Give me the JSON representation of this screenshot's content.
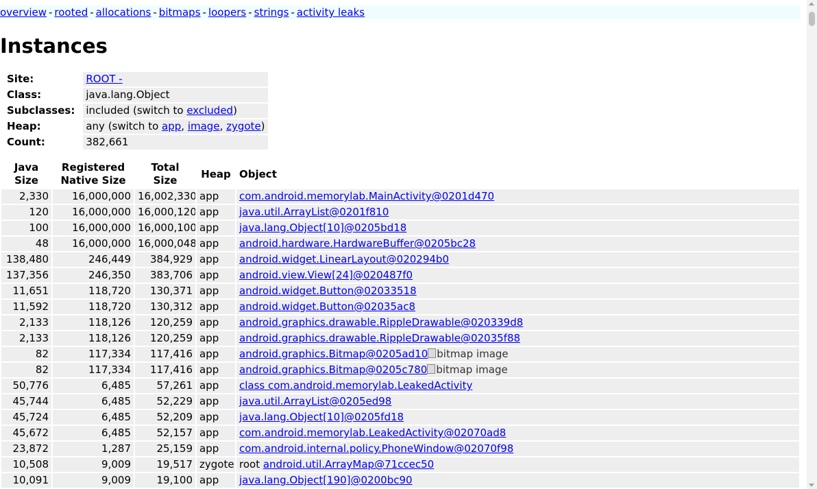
{
  "nav": {
    "links": [
      {
        "label": "overview",
        "id": "overview"
      },
      {
        "label": "rooted",
        "id": "rooted"
      },
      {
        "label": "allocations",
        "id": "allocations"
      },
      {
        "label": "bitmaps",
        "id": "bitmaps"
      },
      {
        "label": "loopers",
        "id": "loopers"
      },
      {
        "label": "strings",
        "id": "strings"
      },
      {
        "label": "activity leaks",
        "id": "activity-leaks"
      }
    ],
    "separator": "-"
  },
  "page_title": "Instances",
  "info": {
    "site": {
      "label": "Site:",
      "link": "ROOT -"
    },
    "class": {
      "label": "Class:",
      "value": "java.lang.Object"
    },
    "subclasses": {
      "label": "Subclasses:",
      "prefix": "included (switch to ",
      "link": "excluded",
      "suffix": ")"
    },
    "heap": {
      "label": "Heap:",
      "prefix": "any (switch to ",
      "links": [
        "app",
        "image",
        "zygote"
      ],
      "comma": ", ",
      "suffix": ")"
    },
    "count": {
      "label": "Count:",
      "value": "382,661"
    }
  },
  "table": {
    "headers": {
      "java_size": [
        "Java",
        "Size"
      ],
      "native_size": [
        "Registered",
        "Native Size"
      ],
      "total_size": [
        "Total",
        "Size"
      ],
      "heap": "Heap",
      "object": "Object"
    },
    "rows": [
      {
        "java": "2,330",
        "native": "16,000,000",
        "total": "16,002,330",
        "heap": "app",
        "prefix": "",
        "object": "com.android.memorylab.MainActivity@0201d470",
        "bitmap": ""
      },
      {
        "java": "120",
        "native": "16,000,000",
        "total": "16,000,120",
        "heap": "app",
        "prefix": "",
        "object": "java.util.ArrayList@0201f810",
        "bitmap": ""
      },
      {
        "java": "100",
        "native": "16,000,000",
        "total": "16,000,100",
        "heap": "app",
        "prefix": "",
        "object": "java.lang.Object[10]@0205bd18",
        "bitmap": ""
      },
      {
        "java": "48",
        "native": "16,000,000",
        "total": "16,000,048",
        "heap": "app",
        "prefix": "",
        "object": "android.hardware.HardwareBuffer@0205bc28",
        "bitmap": ""
      },
      {
        "java": "138,480",
        "native": "246,449",
        "total": "384,929",
        "heap": "app",
        "prefix": "",
        "object": "android.widget.LinearLayout@020294b0",
        "bitmap": ""
      },
      {
        "java": "137,356",
        "native": "246,350",
        "total": "383,706",
        "heap": "app",
        "prefix": "",
        "object": "android.view.View[24]@020487f0",
        "bitmap": ""
      },
      {
        "java": "11,651",
        "native": "118,720",
        "total": "130,371",
        "heap": "app",
        "prefix": "",
        "object": "android.widget.Button@02033518",
        "bitmap": ""
      },
      {
        "java": "11,592",
        "native": "118,720",
        "total": "130,312",
        "heap": "app",
        "prefix": "",
        "object": "android.widget.Button@02035ac8",
        "bitmap": ""
      },
      {
        "java": "2,133",
        "native": "118,126",
        "total": "120,259",
        "heap": "app",
        "prefix": "",
        "object": "android.graphics.drawable.RippleDrawable@020339d8",
        "bitmap": ""
      },
      {
        "java": "2,133",
        "native": "118,126",
        "total": "120,259",
        "heap": "app",
        "prefix": "",
        "object": "android.graphics.drawable.RippleDrawable@02035f88",
        "bitmap": ""
      },
      {
        "java": "82",
        "native": "117,334",
        "total": "117,416",
        "heap": "app",
        "prefix": "",
        "object": "android.graphics.Bitmap@0205ad10",
        "bitmap": "bitmap image"
      },
      {
        "java": "82",
        "native": "117,334",
        "total": "117,416",
        "heap": "app",
        "prefix": "",
        "object": "android.graphics.Bitmap@0205c780",
        "bitmap": "bitmap image"
      },
      {
        "java": "50,776",
        "native": "6,485",
        "total": "57,261",
        "heap": "app",
        "prefix": "",
        "object": "class com.android.memorylab.LeakedActivity",
        "bitmap": ""
      },
      {
        "java": "45,744",
        "native": "6,485",
        "total": "52,229",
        "heap": "app",
        "prefix": "",
        "object": "java.util.ArrayList@0205ed98",
        "bitmap": ""
      },
      {
        "java": "45,724",
        "native": "6,485",
        "total": "52,209",
        "heap": "app",
        "prefix": "",
        "object": "java.lang.Object[10]@0205fd18",
        "bitmap": ""
      },
      {
        "java": "45,672",
        "native": "6,485",
        "total": "52,157",
        "heap": "app",
        "prefix": "",
        "object": "com.android.memorylab.LeakedActivity@02070ad8",
        "bitmap": ""
      },
      {
        "java": "23,872",
        "native": "1,287",
        "total": "25,159",
        "heap": "app",
        "prefix": "",
        "object": "com.android.internal.policy.PhoneWindow@02070f98",
        "bitmap": ""
      },
      {
        "java": "10,508",
        "native": "9,009",
        "total": "19,517",
        "heap": "zygote",
        "prefix": "root ",
        "object": "android.util.ArrayMap@71ccec50",
        "bitmap": ""
      },
      {
        "java": "10,091",
        "native": "9,009",
        "total": "19,100",
        "heap": "app",
        "prefix": "",
        "object": "java.lang.Object[190]@0200bc90",
        "bitmap": ""
      }
    ]
  }
}
